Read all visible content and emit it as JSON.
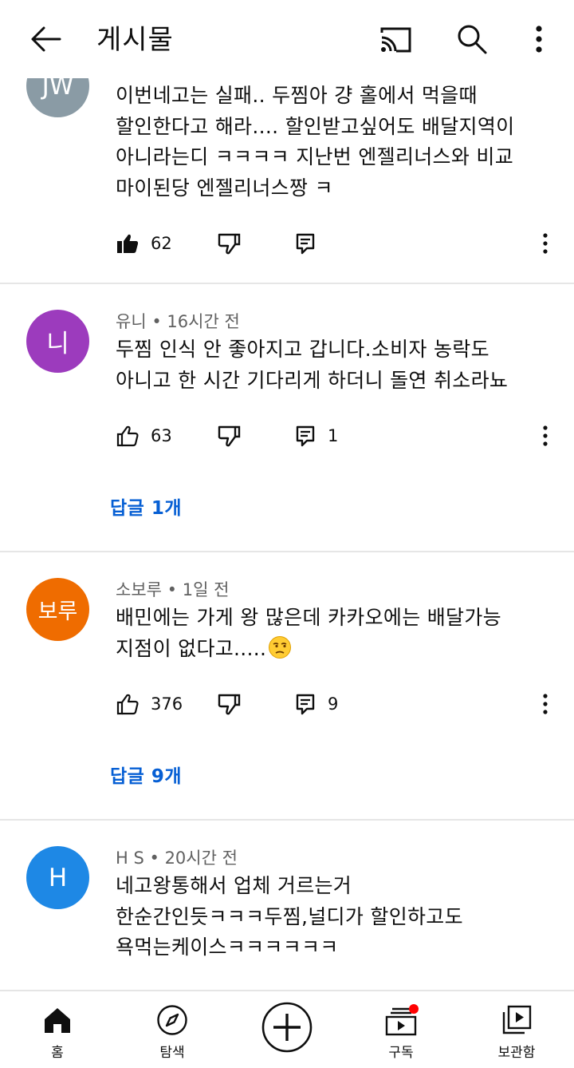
{
  "header": {
    "title": "게시물",
    "back_icon": "back-arrow-icon",
    "cast_icon": "cast-icon",
    "search_icon": "search-icon",
    "more_icon": "more-vert-icon"
  },
  "comments": [
    {
      "avatar_text": "JW",
      "avatar_color": "#8a9ba5",
      "author": "",
      "time": "",
      "lines": [
        "이번네고는 실패.. 두찜아 걍 홀에서 먹을때",
        "할인한다고 해라.... 할인받고싶어도 배달지역이",
        "아니라는디 ㅋㅋㅋㅋ 지난번 엔젤리너스와 비교",
        "마이된당 엔젤리너스짱 ㅋ"
      ],
      "likes": "62",
      "liked": true,
      "replies_count": ""
    },
    {
      "avatar_text": "니",
      "avatar_color": "#9c3bbd",
      "author": "유니",
      "time": "16시간 전",
      "lines": [
        "두찜 인식 안 좋아지고 갑니다.소비자 농락도",
        "아니고 한 시간 기다리게 하더니 돌연 취소라뇨"
      ],
      "likes": "63",
      "liked": false,
      "replies_count": "1",
      "replies_link": "답글 1개"
    },
    {
      "avatar_text": "보루",
      "avatar_color": "#ef6c00",
      "author": "소보루",
      "time": "1일 전",
      "lines": [
        "배민에는 가게 왕 많은데 카카오에는 배달가능",
        "지점이 없다고....."
      ],
      "emoji": "😒",
      "likes": "376",
      "liked": false,
      "replies_count": "9",
      "replies_link": "답글 9개"
    },
    {
      "avatar_text": "H",
      "avatar_color": "#1e88e5",
      "author": "H S",
      "time": "20시간 전",
      "lines": [
        "네고왕통해서 업체 거르는거",
        "한순간인듯ㅋㅋㅋ두찜,널디가 할인하고도",
        "욕먹는케이스ㅋㅋㅋㅋㅋㅋ"
      ]
    }
  ],
  "meta_separator": "•",
  "bottom_nav": {
    "home": "홈",
    "explore": "탐색",
    "create_icon": "add-circle-icon",
    "subscriptions": "구독",
    "library": "보관함",
    "notification_dot_color": "#ff0000"
  }
}
